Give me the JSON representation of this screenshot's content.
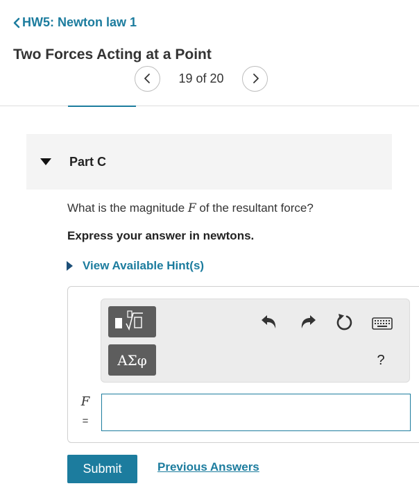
{
  "header": {
    "back_label": "HW5: Newton law 1",
    "title": "Two Forces Acting at a Point"
  },
  "pager": {
    "position_text": "19 of 20",
    "prev_icon": "chevron-left-icon",
    "next_icon": "chevron-right-icon"
  },
  "part": {
    "label": "Part C",
    "expanded": true
  },
  "question": {
    "prefix": "What is the magnitude ",
    "variable": "F",
    "suffix": " of the resultant force?",
    "instruction": "Express your answer in newtons."
  },
  "hint": {
    "label": "View Available Hint(s)"
  },
  "toolbar": {
    "templates_icon": "math-templates-icon",
    "symbols_label": "ΑΣφ",
    "undo_icon": "undo-icon",
    "redo_icon": "redo-icon",
    "reset_icon": "reset-icon",
    "keyboard_icon": "keyboard-icon",
    "help_label": "?"
  },
  "answer": {
    "variable_label": "F",
    "equals_label": "=",
    "value": ""
  },
  "actions": {
    "submit_label": "Submit",
    "previous_answers_label": "Previous Answers"
  },
  "colors": {
    "accent": "#1c7c9e",
    "toolbar_button": "#5d5d5d",
    "part_header_bg": "#f4f4f4"
  }
}
